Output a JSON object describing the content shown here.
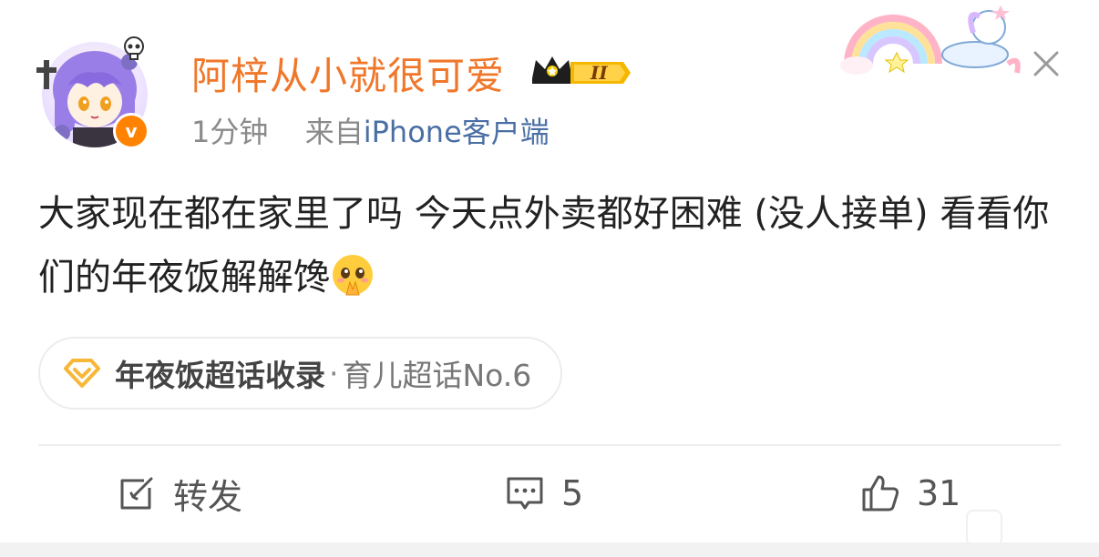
{
  "header": {
    "username": "阿梓从小就很可爱",
    "vip_level": "II",
    "timestamp": "1分钟",
    "from_prefix": "来自",
    "source": "iPhone客户端"
  },
  "post": {
    "text": "大家现在都在家里了吗 今天点外卖都好困难 (没人接单) 看看你们的年夜饭解解馋",
    "emoji": "pleading-face-emoji"
  },
  "topic": {
    "name": "年夜饭超话收录",
    "separator": "·",
    "rank": "育儿超话No.6",
    "icon": "diamond-icon"
  },
  "actions": {
    "repost_label": "转发",
    "comment_count": "5",
    "like_count": "31"
  },
  "colors": {
    "username": "#f0772a",
    "verified": "#ff8200",
    "source_link": "#4a6fa5",
    "vip_gold": "#f5b800",
    "topic_icon": "#f7b739"
  }
}
